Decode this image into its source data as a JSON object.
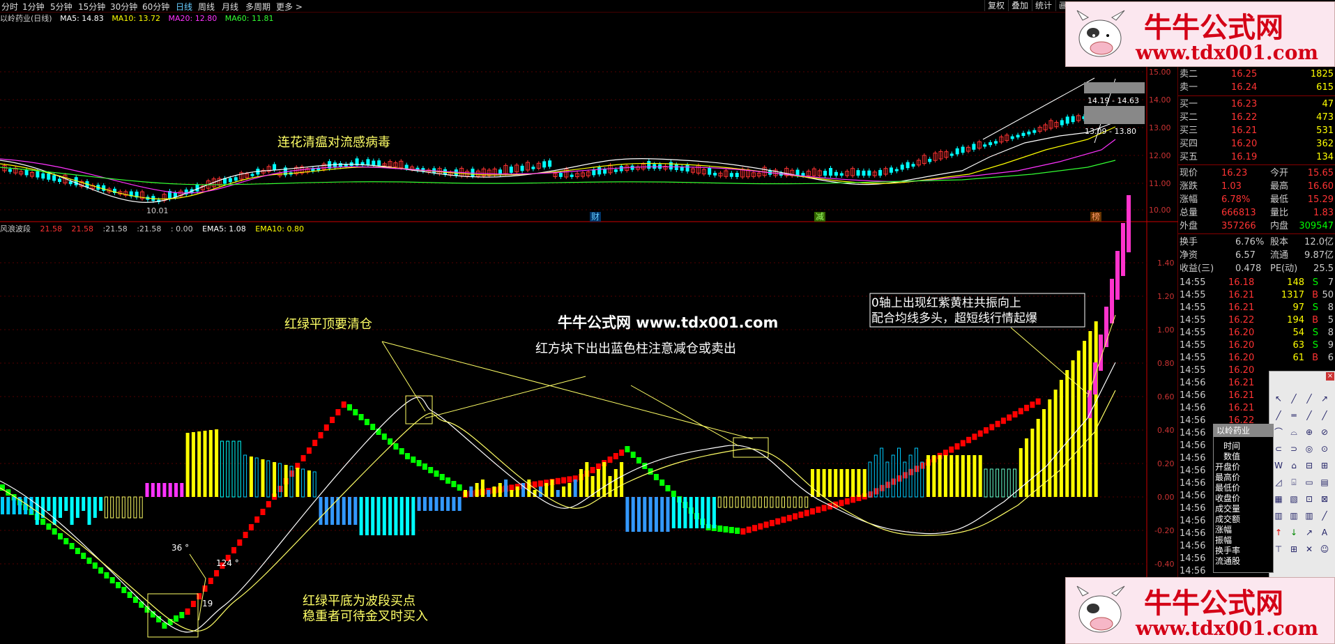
{
  "toolbar": {
    "periods": [
      "分时",
      "1分钟",
      "5分钟",
      "15分钟",
      "30分钟",
      "60分钟",
      "日线",
      "周线",
      "月线",
      "多周期",
      "更多 >"
    ],
    "active_period": "日线",
    "right_buttons": [
      "复权",
      "叠加",
      "统计",
      "画"
    ]
  },
  "main_info": {
    "stock": "以岭药业(日线)",
    "ma5": "MA5: 14.83",
    "ma10": "MA10: 13.72",
    "ma20": "MA20: 12.80",
    "ma60": "MA60: 11.81"
  },
  "main_chart": {
    "annotation": "连花清瘟对流感病毒",
    "low_label": "10.01",
    "range1": "14.19 - 14.63",
    "range2": "13.09 - 13.80",
    "markers": [
      "财",
      "减",
      "榜"
    ],
    "axis_ticks": [
      "15.00",
      "14.00",
      "13.00",
      "12.00",
      "11.00",
      "10.00"
    ]
  },
  "indicator_info": {
    "name": "风浪波段",
    "v1": "21.58",
    "v2": "21.58",
    "v3": ":21.58",
    "v4": ":21.58",
    "v5": ": 0.00",
    "ema5": "EMA5: 1.08",
    "ema10": "EMA10: 0.80"
  },
  "indicator_chart": {
    "axis_ticks": [
      "1.40",
      "1.20",
      "1.00",
      "0.80",
      "0.60",
      "0.40",
      "0.20",
      "0.00",
      "-0.20",
      "-0.40"
    ],
    "angle1": "36 °",
    "angle2": "124 °",
    "angle3": "19",
    "note_top_left": "红绿平顶要清仓",
    "watermark": "牛牛公式网 www.tdx001.com",
    "note_center": "红方块下出出蓝色柱注意减仓或卖出",
    "note_box_line1": "0轴上出现红紫黄柱共振向上",
    "note_box_line2": "配合均线多头，超短线行情起爆",
    "note_bottom_line1": "红绿平底为波段买点",
    "note_bottom_line2": "稳重者可待金叉时买入"
  },
  "quote_panel": {
    "sell_rows": [
      {
        "label": "卖二",
        "price": "16.25",
        "vol": "1825"
      },
      {
        "label": "卖一",
        "price": "16.24",
        "vol": "615"
      }
    ],
    "buy_rows": [
      {
        "label": "买一",
        "price": "16.23",
        "vol": "47"
      },
      {
        "label": "买二",
        "price": "16.22",
        "vol": "473"
      },
      {
        "label": "买三",
        "price": "16.21",
        "vol": "531"
      },
      {
        "label": "买四",
        "price": "16.20",
        "vol": "362"
      },
      {
        "label": "买五",
        "price": "16.19",
        "vol": "134"
      }
    ],
    "stats": [
      {
        "k1": "现价",
        "v1": "16.23",
        "k2": "今开",
        "v2": "15.65"
      },
      {
        "k1": "涨跌",
        "v1": "1.03",
        "k2": "最高",
        "v2": "16.60"
      },
      {
        "k1": "涨幅",
        "v1": "6.78%",
        "k2": "最低",
        "v2": "15.29"
      },
      {
        "k1": "总量",
        "v1": "666813",
        "k2": "量比",
        "v2": "1.83"
      },
      {
        "k1": "外盘",
        "v1": "357266",
        "k2": "内盘",
        "v2": "309547"
      }
    ],
    "fund": [
      {
        "k1": "换手",
        "v1": "6.76%",
        "k2": "股本",
        "v2": "12.0亿"
      },
      {
        "k1": "净资",
        "v1": "6.57",
        "k2": "流通",
        "v2": "9.87亿"
      },
      {
        "k1": "收益(三)",
        "v1": "0.478",
        "k2": "PE(动)",
        "v2": "25.5"
      }
    ],
    "ticks": [
      {
        "t": "14:55",
        "p": "16.18",
        "v": "148",
        "s": "S",
        "n": "7"
      },
      {
        "t": "14:55",
        "p": "16.21",
        "v": "1317",
        "s": "B",
        "n": "50"
      },
      {
        "t": "14:55",
        "p": "16.21",
        "v": "97",
        "s": "S",
        "n": "8"
      },
      {
        "t": "14:55",
        "p": "16.22",
        "v": "194",
        "s": "B",
        "n": "5"
      },
      {
        "t": "14:55",
        "p": "16.20",
        "v": "54",
        "s": "S",
        "n": "8"
      },
      {
        "t": "14:55",
        "p": "16.20",
        "v": "63",
        "s": "S",
        "n": "9"
      },
      {
        "t": "14:55",
        "p": "16.20",
        "v": "61",
        "s": "B",
        "n": "6"
      },
      {
        "t": "14:55",
        "p": "16.20",
        "v": "",
        "s": "",
        "n": ""
      },
      {
        "t": "14:56",
        "p": "16.21",
        "v": "",
        "s": "",
        "n": ""
      },
      {
        "t": "14:56",
        "p": "16.21",
        "v": "",
        "s": "",
        "n": ""
      },
      {
        "t": "14:56",
        "p": "16.21",
        "v": "",
        "s": "",
        "n": ""
      },
      {
        "t": "14:56",
        "p": "16.22",
        "v": "",
        "s": "",
        "n": ""
      },
      {
        "t": "14:56",
        "p": "",
        "v": "",
        "s": "",
        "n": ""
      },
      {
        "t": "14:56",
        "p": "",
        "v": "",
        "s": "",
        "n": ""
      },
      {
        "t": "14:56",
        "p": "",
        "v": "",
        "s": "",
        "n": ""
      },
      {
        "t": "14:56",
        "p": "",
        "v": "",
        "s": "",
        "n": ""
      },
      {
        "t": "14:56",
        "p": "",
        "v": "",
        "s": "",
        "n": ""
      },
      {
        "t": "14:56",
        "p": "",
        "v": "",
        "s": "",
        "n": ""
      },
      {
        "t": "14:56",
        "p": "",
        "v": "",
        "s": "",
        "n": ""
      },
      {
        "t": "14:56",
        "p": "",
        "v": "",
        "s": "",
        "n": ""
      },
      {
        "t": "14:56",
        "p": "",
        "v": "",
        "s": "",
        "n": ""
      },
      {
        "t": "14:56",
        "p": "",
        "v": "",
        "s": "",
        "n": ""
      },
      {
        "t": "14:56",
        "p": "",
        "v": "",
        "s": "",
        "n": ""
      },
      {
        "t": "14:56",
        "p": "",
        "v": "",
        "s": "",
        "n": ""
      },
      {
        "t": "14:56",
        "p": "16.24",
        "v": "",
        "s": "",
        "n": ""
      }
    ]
  },
  "popup_window": {
    "title": "以岭药业",
    "items": [
      "时间",
      "数值",
      "开盘价",
      "最高价",
      "最低价",
      "收盘价",
      "成交量",
      "成交额",
      "涨幅",
      "振幅",
      "换手率",
      "流通股"
    ]
  },
  "logo": {
    "title": "牛牛公式网",
    "url": "www.tdx001.com"
  },
  "colors": {
    "up": "#ff3333",
    "down": "#00ffff",
    "green_block": "#00ff00",
    "red_block": "#ff0000",
    "magenta": "#ff33ff",
    "yellow": "#ffff00",
    "blue": "#3399ff",
    "axis": "#cc0000"
  }
}
